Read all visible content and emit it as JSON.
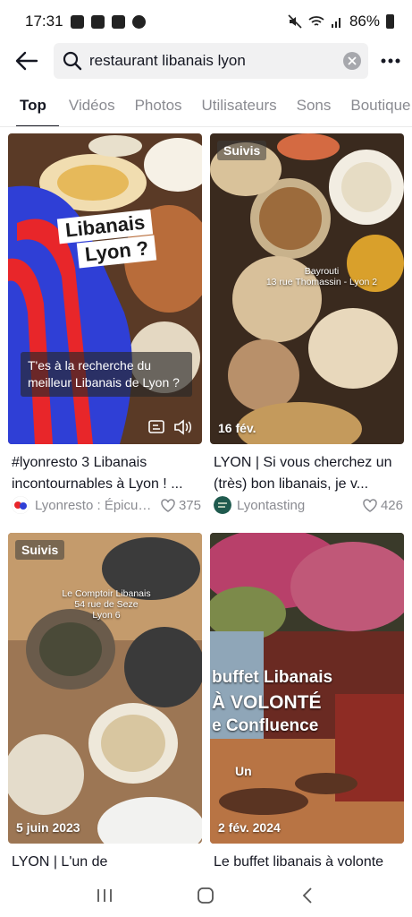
{
  "status_bar": {
    "time": "17:31",
    "battery": "86%"
  },
  "search": {
    "query": "restaurant libanais lyon"
  },
  "tabs": [
    "Top",
    "Vidéos",
    "Photos",
    "Utilisateurs",
    "Sons",
    "Boutique"
  ],
  "results": [
    {
      "title": "#lyonresto 3 Libanais incontournables à Lyon ! ...",
      "author": "Lyonresto : Épicurien lyonnais",
      "likes": "375",
      "overlay_top": "Libanais",
      "overlay_bottom": "Lyon ?",
      "caption": "T'es à la recherche du meilleur Libanais de Lyon ?"
    },
    {
      "title": "LYON | Si vous cherchez un (très) bon libanais, je v...",
      "author": "Lyontasting",
      "likes": "426",
      "chip": "Suivis",
      "date": "16 fév.",
      "location": "Bayrouti\n13 rue Thomassin - Lyon 2"
    },
    {
      "title": "LYON | L'un de",
      "chip": "Suivis",
      "date": "5 juin 2023",
      "location": "Le Comptoir Libanais\n54 rue de Seze\nLyon 6"
    },
    {
      "title": "Le buffet libanais à volonte",
      "date": "2 fév. 2024",
      "overlay_line1": "buffet Libanais",
      "overlay_line2": "À VOLONTÉ",
      "overlay_line3": "e Confluence",
      "overlay_line4": "Un"
    }
  ]
}
